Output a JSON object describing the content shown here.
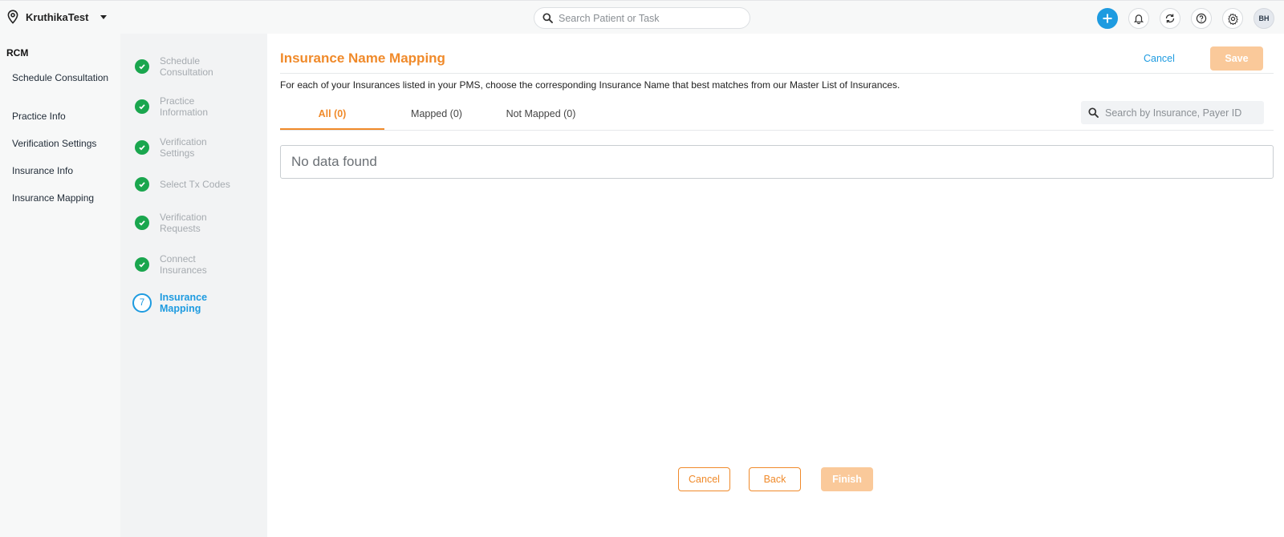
{
  "header": {
    "location_name": "KruthikaTest",
    "search_placeholder": "Search Patient or Task",
    "avatar_initials": "BH",
    "accent_color": "#1e9be0"
  },
  "left_nav": {
    "section": "RCM",
    "items": [
      {
        "label": "Schedule Consultation"
      },
      {
        "label": "Practice Info"
      },
      {
        "label": "Verification Settings"
      },
      {
        "label": "Insurance Info"
      },
      {
        "label": "Insurance Mapping"
      }
    ]
  },
  "steps": [
    {
      "label": "Schedule Consultation",
      "status": "complete"
    },
    {
      "label": "Practice Information",
      "status": "complete"
    },
    {
      "label": "Verification Settings",
      "status": "complete"
    },
    {
      "label": "Select Tx Codes",
      "status": "complete"
    },
    {
      "label": "Verification Requests",
      "status": "complete"
    },
    {
      "label": "Connect Insurances",
      "status": "complete"
    },
    {
      "label": "Insurance Mapping",
      "number": "7",
      "status": "active"
    }
  ],
  "main": {
    "title": "Insurance Name Mapping",
    "cancel_label": "Cancel",
    "save_label": "Save",
    "description": "For each of your Insurances listed in your PMS, choose the corresponding Insurance Name that best matches from our Master List of Insurances.",
    "tabs": [
      {
        "label": "All (0)",
        "active": true
      },
      {
        "label": "Mapped (0)",
        "active": false
      },
      {
        "label": "Not Mapped (0)",
        "active": false
      }
    ],
    "search_placeholder": "Search by Insurance, Payer ID",
    "empty_message": "No data found",
    "primary_color": "#f08a2a"
  },
  "footer": {
    "cancel_label": "Cancel",
    "back_label": "Back",
    "finish_label": "Finish"
  }
}
